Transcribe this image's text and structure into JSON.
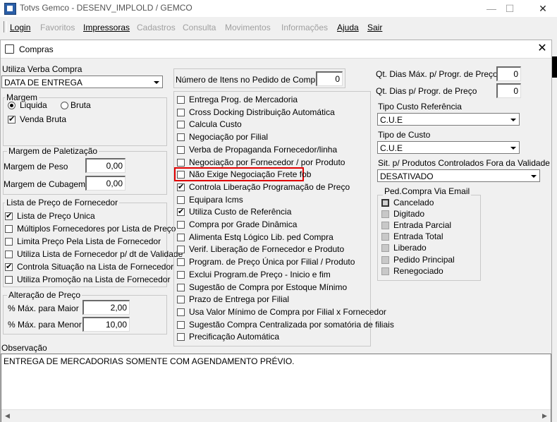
{
  "window": {
    "title": "Totvs Gemco - DESENV_IMPLOLD / GEMCO",
    "min": "—",
    "max": "☐",
    "close": "✕"
  },
  "menu": [
    {
      "label": "Login",
      "enabled": true
    },
    {
      "label": "Favoritos",
      "enabled": false
    },
    {
      "label": "Impressoras",
      "enabled": true
    },
    {
      "label": "Cadastros",
      "enabled": false
    },
    {
      "label": "Consulta",
      "enabled": false
    },
    {
      "label": "Movimentos",
      "enabled": false
    },
    {
      "label": "Informações",
      "enabled": false
    },
    {
      "label": "Ajuda",
      "enabled": true
    },
    {
      "label": "Sair",
      "enabled": true
    }
  ],
  "dialog": {
    "title": "Compras",
    "close": "✕"
  },
  "left": {
    "utiliza_verba_label": "Utiliza Verba Compra",
    "utiliza_verba_value": "DATA DE ENTREGA",
    "margem": {
      "title": "Margem",
      "liquida": "Liquida",
      "bruta": "Bruta",
      "venda_bruta": "Venda Bruta"
    },
    "paletizacao": {
      "title": "Margem de Paletização",
      "peso_label": "Margem de Peso",
      "peso_value": "0,00",
      "cubagem_label": "Margem de Cubagem",
      "cubagem_value": "0,00"
    },
    "lista_preco": {
      "title": "Lista de Preço de Fornecedor",
      "items": [
        {
          "label": "Lista de Preço Unica",
          "checked": true
        },
        {
          "label": "Múltiplos Fornecedores por Lista de Preço",
          "checked": false
        },
        {
          "label": "Limita Preço Pela Lista de Fornecedor",
          "checked": false
        },
        {
          "label": "Utiliza Lista de Fornecedor p/ dt de Validade",
          "checked": false
        },
        {
          "label": "Controla Situação na Lista de Fornecedor",
          "checked": true
        },
        {
          "label": "Utiliza Promoção na Lista de Fornecedor",
          "checked": false
        }
      ]
    },
    "alteracao": {
      "title": "Alteração de Preço",
      "maior_label": "% Máx. para Maior",
      "maior_value": "2,00",
      "menor_label": "% Máx. para Menor",
      "menor_value": "10,00"
    }
  },
  "middle": {
    "num_itens_label": "Número de Itens no Pedido de Compra",
    "num_itens_value": "0",
    "items": [
      {
        "label": "Entrega Prog. de Mercadoria",
        "checked": false
      },
      {
        "label": "Cross Docking Distribuição Automática",
        "checked": false
      },
      {
        "label": "Calcula Custo",
        "checked": false
      },
      {
        "label": "Negociação por Filial",
        "checked": false
      },
      {
        "label": "Verba de Propaganda Fornecedor/linha",
        "checked": false
      },
      {
        "label": "Negociação por Fornecedor / por Produto",
        "checked": false
      },
      {
        "label": "Não Exige Negociação Frete fob",
        "checked": false
      },
      {
        "label": "Controla Liberação Programação de Preço",
        "checked": true
      },
      {
        "label": "Equipara Icms",
        "checked": false
      },
      {
        "label": "Utiliza Custo de Referência",
        "checked": true
      },
      {
        "label": "Compra por Grade Dinâmica",
        "checked": false
      },
      {
        "label": "Alimenta Estq Lógico Lib. ped Compra",
        "checked": false
      },
      {
        "label": "Verif. Liberação de Fornecedor e Produto",
        "checked": false
      },
      {
        "label": "Program. de Preço Única por Filial / Produto",
        "checked": false
      },
      {
        "label": "Exclui Program.de Preço - Inicio e fim",
        "checked": false
      },
      {
        "label": "Sugestão de Compra por Estoque Mínimo",
        "checked": false
      },
      {
        "label": "Prazo de Entrega por Filial",
        "checked": false
      },
      {
        "label": "Usa Valor Mínimo de Compra por Filial x Fornecedor",
        "checked": false
      },
      {
        "label": "Sugestão Compra Centralizada por somatória de filiais",
        "checked": false
      },
      {
        "label": "Precificação Automática",
        "checked": false
      }
    ]
  },
  "right": {
    "qt_dias_max_label": "Qt. Dias Máx. p/ Progr. de Preço",
    "qt_dias_max_value": "0",
    "qt_dias_label": "Qt. Dias p/ Progr. de Preço",
    "qt_dias_value": "0",
    "tipo_custo_ref_label": "Tipo Custo Referência",
    "tipo_custo_ref_value": "C.U.E",
    "tipo_custo_label": "Tipo de Custo",
    "tipo_custo_value": "C.U.E",
    "sit_label": "Sit. p/ Produtos Controlados Fora da Validade",
    "sit_value": "DESATIVADO",
    "ped_compra": {
      "title": "Ped.Compra Via Email",
      "items": [
        {
          "label": "Cancelado",
          "checked": true
        },
        {
          "label": "Digitado",
          "checked": false
        },
        {
          "label": "Entrada Parcial",
          "checked": false
        },
        {
          "label": "Entrada Total",
          "checked": false
        },
        {
          "label": "Liberado",
          "checked": false
        },
        {
          "label": "Pedido Principal",
          "checked": false
        },
        {
          "label": "Renegociado",
          "checked": false
        }
      ]
    }
  },
  "observacao": {
    "label": "Observação",
    "text": "ENTREGA DE MERCADORIAS SOMENTE COM AGENDAMENTO PRÉVIO.",
    "scroll_left": "◀",
    "scroll_right": "▶"
  }
}
